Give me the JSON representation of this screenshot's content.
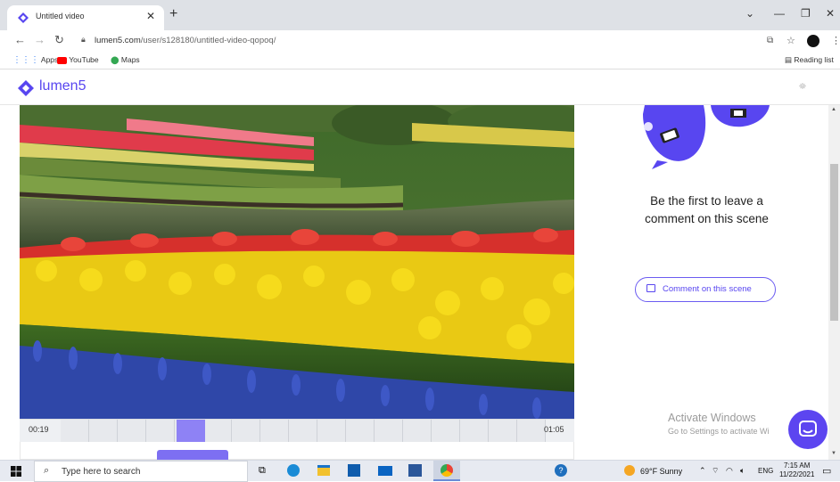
{
  "browser": {
    "tab_title": "Untitled video",
    "url_host": "lumen5.com",
    "url_path": "/user/s128180/untitled-video-qopoq/",
    "bookmarks": [
      {
        "label": "Apps",
        "icon": "apps-grid-icon"
      },
      {
        "label": "YouTube",
        "icon": "youtube-icon"
      },
      {
        "label": "Maps",
        "icon": "maps-pin-icon"
      }
    ],
    "reading_list": "Reading list"
  },
  "app": {
    "logo": "lumen5",
    "brand_color": "#5846f0"
  },
  "timeline": {
    "start_time": "00:19",
    "end_time": "01:05"
  },
  "comments": {
    "message": "Be the first to leave a comment on this scene",
    "message_line1": "Be the first to leave a",
    "message_line2": "comment on this scene",
    "button_label": "Comment on this scene"
  },
  "watermark": {
    "title": "Activate Windows",
    "subtitle": "Go to Settings to activate Wi"
  },
  "taskbar": {
    "search_placeholder": "Type here to search",
    "weather": "69°F  Sunny",
    "language": "ENG",
    "time": "7:15 AM",
    "date": "11/22/2021"
  }
}
